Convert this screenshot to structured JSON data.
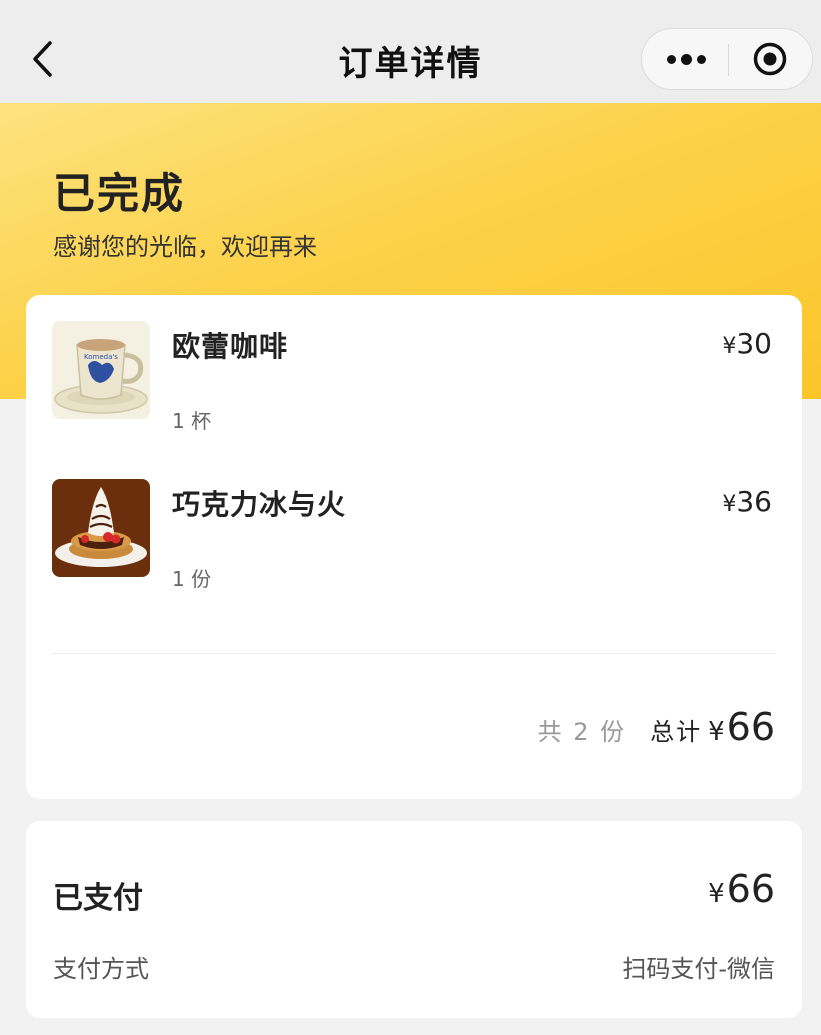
{
  "navbar": {
    "title": "订单详情",
    "back_icon": "chevron-left-icon",
    "more_icon": "more-dots-icon",
    "target_icon": "target-icon"
  },
  "header": {
    "status": "已完成",
    "subtitle": "感谢您的光临，欢迎再来"
  },
  "order": {
    "items": [
      {
        "name": "欧蕾咖啡",
        "price_symbol": "¥",
        "price": "30",
        "quantity": "1 杯",
        "thumb": "coffee-cup-image"
      },
      {
        "name": "巧克力冰与火",
        "price_symbol": "¥",
        "price": "36",
        "quantity": "1 份",
        "thumb": "chocolate-dessert-image"
      }
    ],
    "summary": {
      "count": "共 2 份",
      "total_label": "总计",
      "total_symbol": "¥",
      "total": "66"
    }
  },
  "payment": {
    "status": "已支付",
    "amount_symbol": "¥",
    "amount": "66",
    "method_label": "支付方式",
    "method_value": "扫码支付-微信"
  },
  "colors": {
    "banner_start": "#fde27f",
    "banner_end": "#fbc52a",
    "background": "#f2f2f2",
    "card": "#ffffff"
  }
}
